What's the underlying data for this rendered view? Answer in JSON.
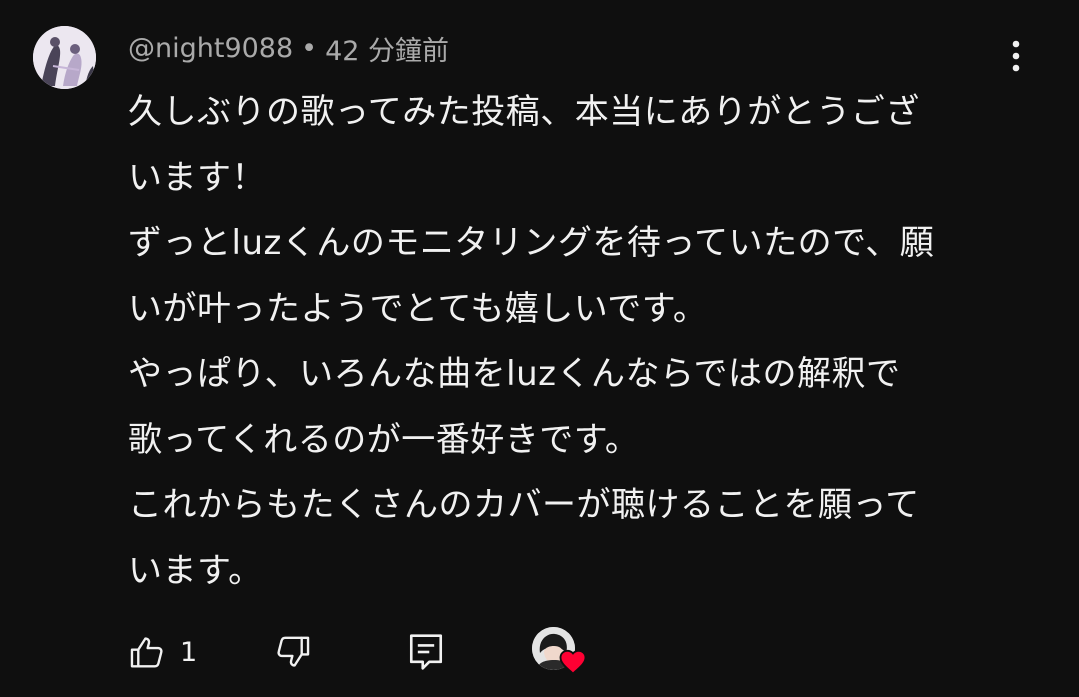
{
  "comment": {
    "author_handle": "@night9088",
    "separator": "•",
    "timestamp": "42 分鐘前",
    "text_lines": [
      "久しぶりの歌ってみた投稿、本当にありがとうござ",
      "います！",
      "ずっとluzくんのモニタリングを待っていたので、願",
      "いが叶ったようでとても嬉しいです。",
      "やっぱり、いろんな曲をluzくんならではの解釈で",
      "歌ってくれるのが一番好きです。",
      "これからもたくさんのカバーが聴けることを願って",
      "います。"
    ],
    "like_count": "1",
    "icons": {
      "menu": "more-vert-icon",
      "like": "thumbs-up-icon",
      "dislike": "thumbs-down-icon",
      "reply": "reply-icon",
      "heart": "heart-icon"
    },
    "colors": {
      "background": "#0f0f0f",
      "text": "#f1f1f1",
      "meta_text": "#aaaaaa",
      "heart": "#ff0033"
    }
  }
}
